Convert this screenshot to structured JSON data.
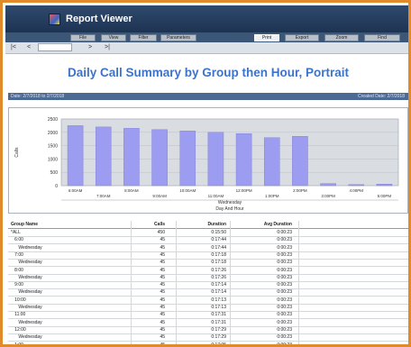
{
  "app": {
    "title": "Report Viewer"
  },
  "toolbar_tabs": [
    {
      "label": "File",
      "active": false
    },
    {
      "label": "View",
      "active": false
    },
    {
      "label": "Filter",
      "active": false
    },
    {
      "label": "Parameters",
      "active": false
    },
    {
      "label": "Print",
      "active": true
    },
    {
      "label": "Export",
      "active": false
    },
    {
      "label": "Zoom",
      "active": false
    },
    {
      "label": "Find",
      "active": false
    }
  ],
  "navbar": {
    "first": "|<",
    "prev": "<",
    "page_value": "",
    "next": ">",
    "last": ">|"
  },
  "report": {
    "title": "Daily Call Summary by Group then Hour, Portrait",
    "date_range": "Date: 2/7/2018 to 2/7/2018",
    "created": "Created Date: 2/7/2018"
  },
  "chart_data": {
    "type": "bar",
    "categories": [
      "6:00AM",
      "7:00AM",
      "8:00AM",
      "9:00AM",
      "10:00AM",
      "11:00AM",
      "12:00PM",
      "1:00PM",
      "2:00PM",
      "3:00PM",
      "4:00PM",
      "5:00PM"
    ],
    "x_tick_labels": [
      "6:00AM",
      "7:00AM",
      "8:00AM",
      "9:00AM",
      "10:00AM",
      "11:00AM",
      "12:00PM",
      "1:00PM",
      "2:00PM",
      "3:00PM",
      "4:00PM",
      "5:00PM"
    ],
    "values": [
      2250,
      2200,
      2150,
      2100,
      2050,
      2000,
      1950,
      1800,
      1850,
      80,
      40,
      60
    ],
    "ylabel": "Calls",
    "xlabel": "Day And Hour",
    "x_sublabel": "Wednesday",
    "yticks": [
      0,
      500,
      1000,
      1500,
      2000,
      2500
    ],
    "ylim": [
      0,
      2500
    ],
    "grid": true,
    "bar_color": "#9c9cf0"
  },
  "table": {
    "headers": {
      "group": "Group Name",
      "calls": "Calls",
      "duration": "Duration",
      "avg": "Avg Duration"
    },
    "rows": [
      {
        "group": "*ALL",
        "calls": "450",
        "duration": "0:15:50",
        "avg": "0:00:23"
      },
      {
        "group": "6:00",
        "calls": "45",
        "duration": "0:17:44",
        "avg": "0:00:23"
      },
      {
        "group": "Wednesday",
        "calls": "45",
        "duration": "0:17:44",
        "avg": "0:00:23"
      },
      {
        "group": "7:00",
        "calls": "45",
        "duration": "0:17:18",
        "avg": "0:00:23"
      },
      {
        "group": "Wednesday",
        "calls": "45",
        "duration": "0:17:18",
        "avg": "0:00:23"
      },
      {
        "group": "8:00",
        "calls": "45",
        "duration": "0:17:26",
        "avg": "0:00:23"
      },
      {
        "group": "Wednesday",
        "calls": "45",
        "duration": "0:17:26",
        "avg": "0:00:23"
      },
      {
        "group": "9:00",
        "calls": "45",
        "duration": "0:17:14",
        "avg": "0:00:23"
      },
      {
        "group": "Wednesday",
        "calls": "45",
        "duration": "0:17:14",
        "avg": "0:00:23"
      },
      {
        "group": "10:00",
        "calls": "45",
        "duration": "0:17:13",
        "avg": "0:00:23"
      },
      {
        "group": "Wednesday",
        "calls": "45",
        "duration": "0:17:13",
        "avg": "0:00:23"
      },
      {
        "group": "11:00",
        "calls": "45",
        "duration": "0:17:31",
        "avg": "0:00:23"
      },
      {
        "group": "Wednesday",
        "calls": "45",
        "duration": "0:17:31",
        "avg": "0:00:23"
      },
      {
        "group": "12:00",
        "calls": "45",
        "duration": "0:17:29",
        "avg": "0:00:23"
      },
      {
        "group": "Wednesday",
        "calls": "45",
        "duration": "0:17:29",
        "avg": "0:00:23"
      },
      {
        "group": "1:00",
        "calls": "45",
        "duration": "0:17:05",
        "avg": "0:00:23"
      },
      {
        "group": "Wednesday",
        "calls": "45",
        "duration": "0:17:05",
        "avg": "0:00:23"
      }
    ]
  },
  "colors": {
    "accent": "#3d73c9",
    "frame": "#e08a2a",
    "titlebar": "#1d3352",
    "bar": "#9c9cf0"
  }
}
